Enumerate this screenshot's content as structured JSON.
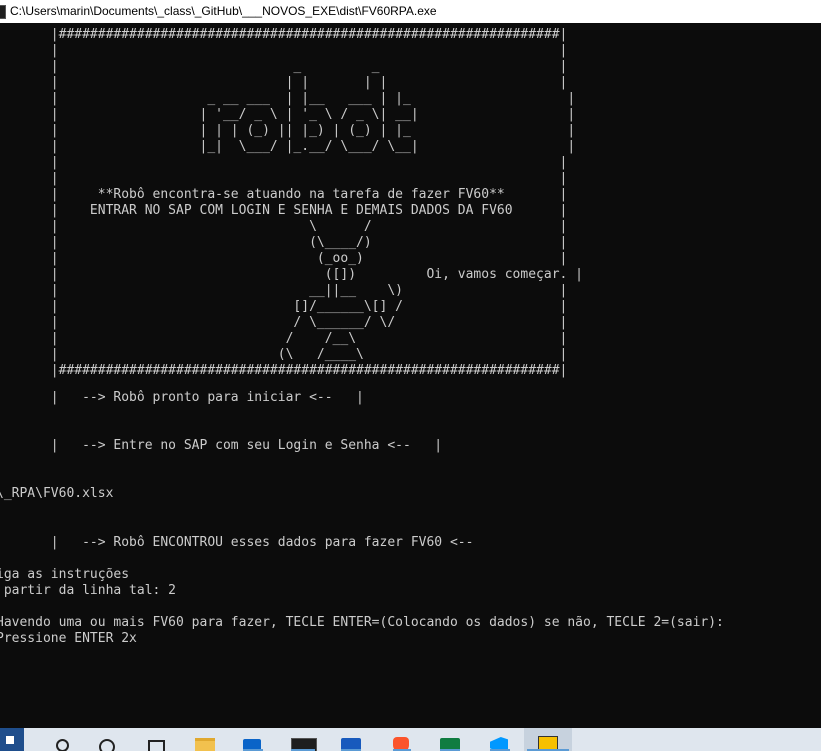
{
  "window": {
    "title": "C:\\Users\\marin\\Documents\\_class\\_GitHub\\___NOVOS_EXE\\dist\\FV60RPA.exe"
  },
  "console": {
    "banner": "       |################################################################|\n       |                                                                |\n       |                              _         _                       |\n       |                             | |       | |                      |\n       |                   _ __ ___  | |__   ___ | |_                    |\n       |                  | '__/ _ \\ | '_ \\ / _ \\| __|                   |\n       |                  | | | (_) || |_) | (_) | |_                    |\n       |                  |_|  \\___/ |_.__/ \\___/ \\__|                   |\n       |                                                                |\n       |                                                                |\n       |     **Robô encontra-se atuando na tarefa de fazer FV60**       |\n       |    ENTRAR NO SAP COM LOGIN E SENHA E DEMAIS DADOS DA FV60      |\n       |                                \\      /                        |\n       |                                (\\____/)                        |\n       |                                 (_oo_)                         |\n       |                                  ([])         Oi, vamos começar. |\n       |                                __||__    \\)                    |\n       |                              []/______\\[] /                    |\n       |                              / \\______/ \\/                     |\n       |                             /    /__\\                          |\n       |                            (\\   /____\\                         |\n       |################################################################|",
    "lines": [
      "",
      "",
      "       |   --> Robô pronto para iniciar <--   |",
      "",
      "",
      "       |   --> Entre no SAP com seu Login e Senha <--   |",
      "",
      "",
      "\\_RPA\\FV60.xlsx",
      "",
      "",
      "       |   --> Robô ENCONTROU esses dados para fazer FV60 <--",
      "iga as instruções",
      " partir da linha tal: 2",
      "",
      "Havendo uma ou mais FV60 para fazer, TECLE ENTER=(Colocando os dados) se não, TECLE 2=(sair):",
      "Pressione ENTER 2x"
    ]
  },
  "taskbar": {
    "items": [
      {
        "name": "start-icon",
        "glyph": "▮",
        "color": "#ffffff"
      },
      {
        "name": "search-icon",
        "glyph": "○",
        "color": "#222222"
      },
      {
        "name": "cortana-icon",
        "glyph": "◯",
        "color": "#222222"
      },
      {
        "name": "task-view-icon",
        "glyph": "▯",
        "color": "#222222"
      },
      {
        "name": "file-explorer-icon",
        "glyph": "▬",
        "color": "#f2c14e"
      },
      {
        "name": "outlook-icon",
        "glyph": "o",
        "color": "#0a64c8"
      },
      {
        "name": "terminal-icon",
        "glyph": ">_",
        "color": "#1e1e1e"
      },
      {
        "name": "word-icon",
        "glyph": "W",
        "color": "#185abd"
      },
      {
        "name": "brave-icon",
        "glyph": "▼",
        "color": "#fb542b"
      },
      {
        "name": "excel-icon",
        "glyph": "X",
        "color": "#107c41"
      },
      {
        "name": "vscode-icon",
        "glyph": "≺",
        "color": "#0098ff"
      },
      {
        "name": "python-exe-icon",
        "glyph": "▰",
        "color": "#f7c000"
      }
    ]
  }
}
